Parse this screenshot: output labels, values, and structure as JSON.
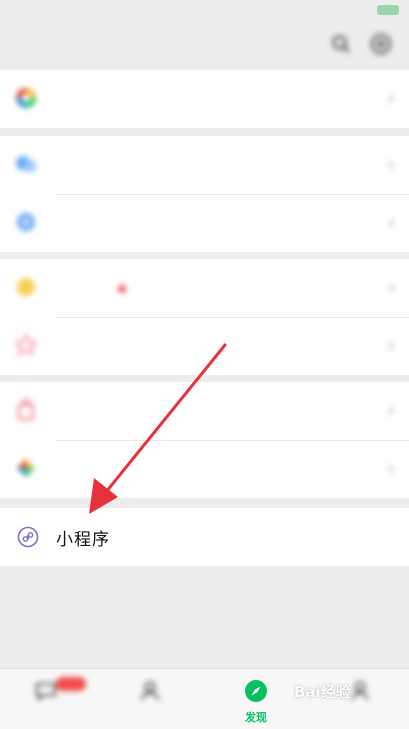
{
  "colors": {
    "accent": "#07c160",
    "arrow": "#e8313a",
    "badge": "#f24b4b"
  },
  "header": {
    "title": ""
  },
  "menu": {
    "mini_programs_label": "小程序"
  },
  "tabbar": {
    "active_tab_label": "发现"
  },
  "watermark": {
    "text": "Bai经验"
  }
}
